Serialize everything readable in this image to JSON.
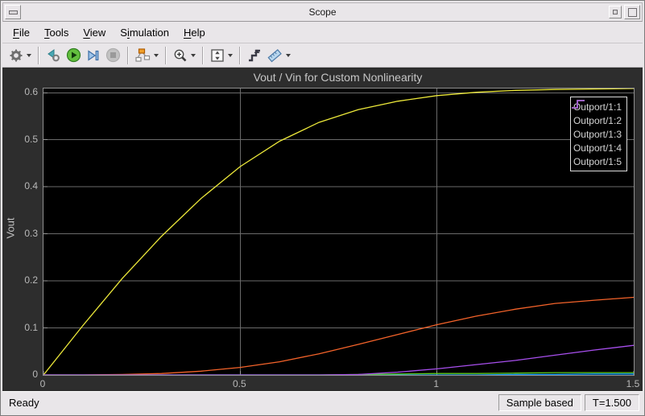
{
  "window": {
    "title": "Scope"
  },
  "menu": {
    "items": [
      {
        "pre": "",
        "key": "F",
        "post": "ile"
      },
      {
        "pre": "",
        "key": "T",
        "post": "ools"
      },
      {
        "pre": "",
        "key": "V",
        "post": "iew"
      },
      {
        "pre": "S",
        "key": "i",
        "post": "mulation"
      },
      {
        "pre": "",
        "key": "H",
        "post": "elp"
      }
    ]
  },
  "toolbar": {
    "icons": [
      {
        "name": "settings-gear-icon",
        "dropdown": true
      },
      {
        "name": "step-back-icon",
        "dropdown": false
      },
      {
        "name": "run-icon",
        "dropdown": false
      },
      {
        "name": "step-forward-icon",
        "dropdown": false
      },
      {
        "name": "stop-icon",
        "dropdown": false,
        "disabled": true
      },
      {
        "name": "highlight-block-icon",
        "dropdown": true
      },
      {
        "name": "zoom-icon",
        "dropdown": true
      },
      {
        "name": "fit-to-view-icon",
        "dropdown": true
      },
      {
        "name": "triggers-icon",
        "dropdown": false
      },
      {
        "name": "measurements-icon",
        "dropdown": true
      }
    ]
  },
  "statusbar": {
    "ready": "Ready",
    "sample_mode": "Sample based",
    "time": "T=1.500"
  },
  "chart_data": {
    "type": "line",
    "title": "Vout / Vin for Custom Nonlinearity",
    "xlabel": "",
    "ylabel": "Vout",
    "xlim": [
      0,
      1.5
    ],
    "ylim": [
      0,
      0.609
    ],
    "xticks": [
      0,
      0.5,
      1,
      1.5
    ],
    "xtick_labels": [
      "0",
      "0.5",
      "1",
      "1.5"
    ],
    "yticks": [
      0,
      0.1,
      0.2,
      0.3,
      0.4,
      0.5,
      0.6
    ],
    "ytick_labels": [
      "0",
      "0.1",
      "0.2",
      "0.3",
      "0.4",
      "0.5",
      "0.6"
    ],
    "grid": true,
    "grid_color": "#6b6b6b",
    "background": "#000000",
    "legend_position": "upper-right",
    "x": [
      0,
      0.1,
      0.2,
      0.3,
      0.4,
      0.5,
      0.6,
      0.7,
      0.8,
      0.9,
      1.0,
      1.1,
      1.2,
      1.3,
      1.4,
      1.5
    ],
    "series": [
      {
        "name": "Outport/1:1",
        "color": "#EDE93A",
        "values": [
          0,
          0.105,
          0.205,
          0.295,
          0.375,
          0.443,
          0.497,
          0.537,
          0.564,
          0.582,
          0.594,
          0.601,
          0.605,
          0.607,
          0.608,
          0.609
        ]
      },
      {
        "name": "Outport/1:2",
        "color": "#139FFF",
        "values": [
          0,
          0,
          0,
          0,
          0,
          0,
          0,
          0,
          0,
          0,
          0,
          0,
          0.001,
          0.001,
          0.002,
          0.002
        ]
      },
      {
        "name": "Outport/1:3",
        "color": "#F4632A",
        "values": [
          0,
          0,
          0.001,
          0.003,
          0.008,
          0.016,
          0.028,
          0.045,
          0.065,
          0.086,
          0.107,
          0.125,
          0.14,
          0.152,
          0.159,
          0.165
        ]
      },
      {
        "name": "Outport/1:4",
        "color": "#5FCC1C",
        "values": [
          0,
          0,
          0,
          0,
          0,
          0,
          0,
          0,
          0.001,
          0.002,
          0.003,
          0.003,
          0.004,
          0.005,
          0.005,
          0.005
        ]
      },
      {
        "name": "Outport/1:5",
        "color": "#A84FEE",
        "values": [
          0,
          0,
          0,
          0,
          0,
          0,
          0,
          0,
          0.001,
          0.006,
          0.013,
          0.022,
          0.031,
          0.042,
          0.053,
          0.063
        ]
      }
    ]
  }
}
